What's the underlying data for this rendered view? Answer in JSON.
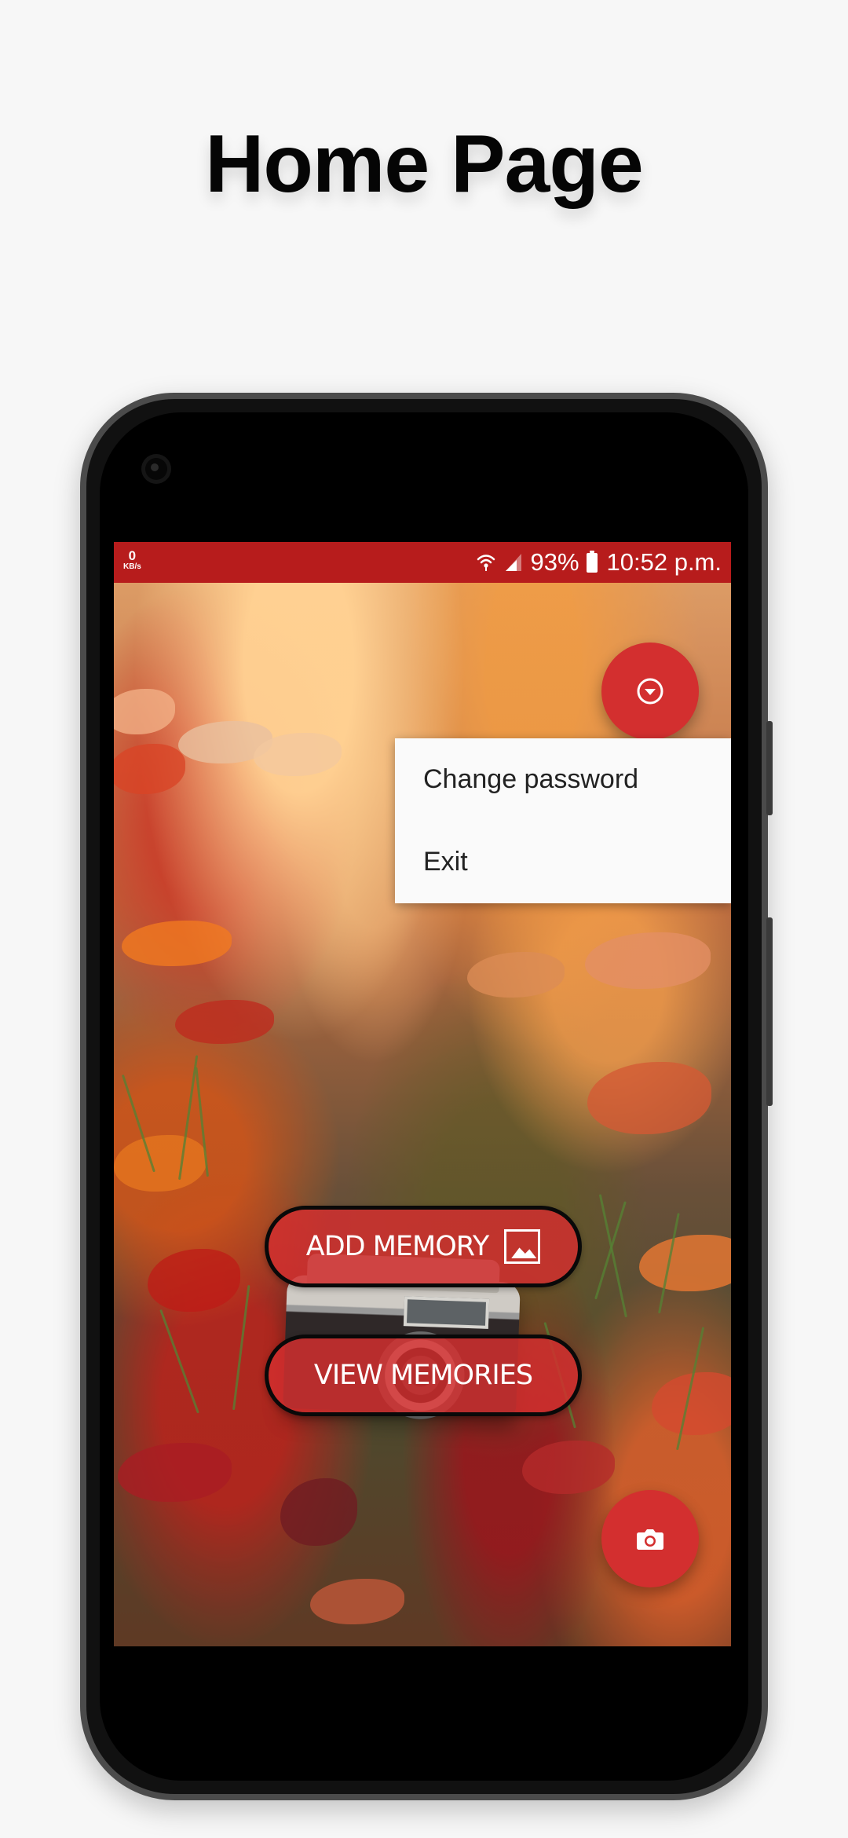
{
  "page": {
    "title": "Home Page"
  },
  "status_bar": {
    "speed_value": "0",
    "speed_unit": "KB/s",
    "battery": "93%",
    "time": "10:52 p.m.",
    "background_color": "#b71c1c"
  },
  "fab_menu": {
    "icon": "chevron-down-circle-icon",
    "color": "#d32f2f"
  },
  "popup_menu": {
    "items": [
      {
        "label": "Change password"
      },
      {
        "label": "Exit"
      }
    ]
  },
  "main_actions": {
    "add_memory_label": "ADD MEMORY",
    "add_memory_icon": "image-icon",
    "view_memories_label": "VIEW MEMORIES",
    "button_color": "#d32f2f"
  },
  "fab_camera": {
    "icon": "camera-icon",
    "color": "#d32f2f"
  }
}
